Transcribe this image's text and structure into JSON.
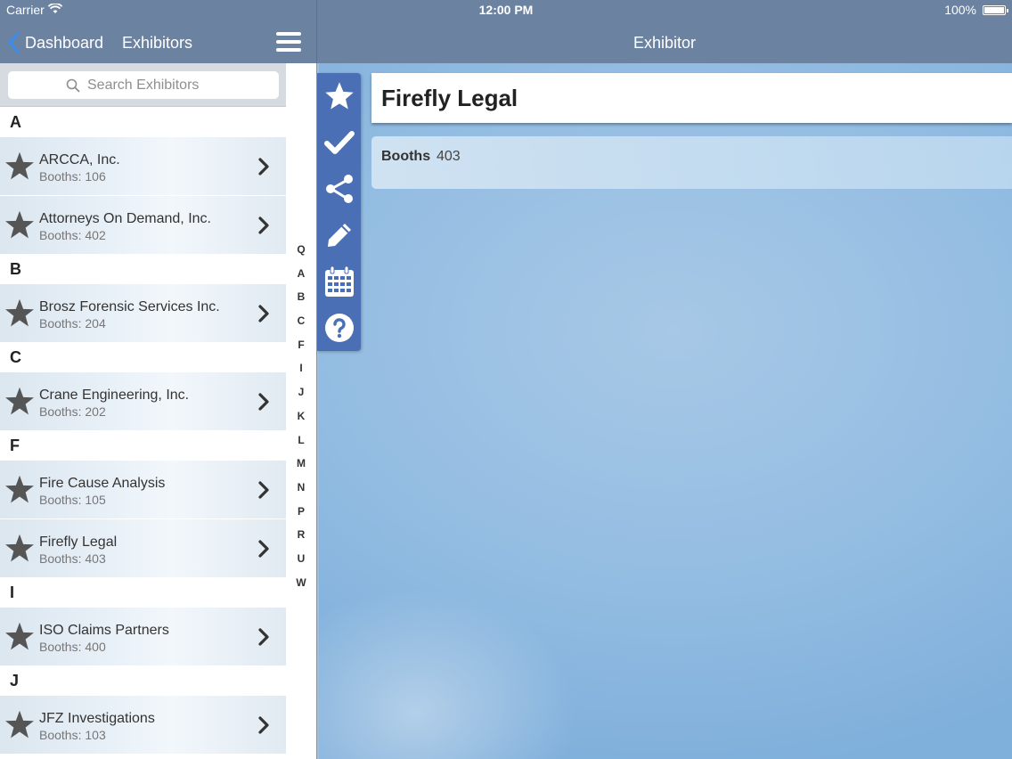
{
  "status_bar": {
    "carrier": "Carrier",
    "time": "12:00 PM",
    "battery": "100%"
  },
  "nav": {
    "back_label": "Dashboard",
    "left_title": "Exhibitors",
    "right_title": "Exhibitor"
  },
  "search": {
    "placeholder": "Search Exhibitors"
  },
  "sections": [
    {
      "letter": "A",
      "items": [
        {
          "name": "ARCCA, Inc.",
          "booths": "Booths: 106"
        },
        {
          "name": "Attorneys On Demand, Inc.",
          "booths": "Booths: 402"
        }
      ]
    },
    {
      "letter": "B",
      "items": [
        {
          "name": "Brosz Forensic Services Inc.",
          "booths": "Booths: 204"
        }
      ]
    },
    {
      "letter": "C",
      "items": [
        {
          "name": "Crane Engineering, Inc.",
          "booths": "Booths: 202"
        }
      ]
    },
    {
      "letter": "F",
      "items": [
        {
          "name": "Fire Cause Analysis",
          "booths": "Booths: 105"
        },
        {
          "name": "Firefly Legal",
          "booths": "Booths: 403"
        }
      ]
    },
    {
      "letter": "I",
      "items": [
        {
          "name": "ISO Claims Partners",
          "booths": "Booths: 400"
        }
      ]
    },
    {
      "letter": "J",
      "items": [
        {
          "name": "JFZ Investigations",
          "booths": "Booths: 103"
        }
      ]
    }
  ],
  "index_letters": [
    "Q",
    "A",
    "B",
    "C",
    "F",
    "I",
    "J",
    "K",
    "L",
    "M",
    "N",
    "P",
    "R",
    "U",
    "W"
  ],
  "toolbar": [
    "star-icon",
    "checkmark-icon",
    "share-icon",
    "pencil-icon",
    "calendar-icon",
    "help-icon"
  ],
  "detail": {
    "title": "Firefly Legal",
    "booth_label": "Booths",
    "booth_value": "403"
  },
  "colors": {
    "nav_bar": "#6b83a1",
    "toolbar": "#4a6fb4",
    "back_chevron": "#3b8cf0"
  }
}
